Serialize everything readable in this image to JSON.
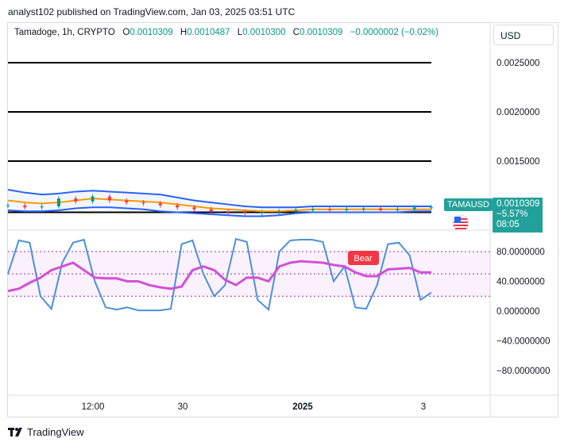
{
  "publisher_line": "analyst102 published on TradingView.com, Jan 03, 2025 03:51 UTC",
  "ohlc": {
    "symbol": "Tamadoge, 1h, CRYPTO",
    "o_label": "O",
    "o": "0.0010309",
    "h_label": "H",
    "h": "0.0010487",
    "l_label": "L",
    "l": "0.0010300",
    "c_label": "C",
    "c": "0.0010309",
    "change": "−0.0000002 (−0.02%)"
  },
  "currency": "USD",
  "price_tag": {
    "symbol": "TAMAUSD",
    "price": "0.0010309",
    "change": "−5.57%",
    "countdown": "08:05"
  },
  "footer": {
    "brand": "TradingView"
  },
  "colors": {
    "up": "#089981",
    "down": "#f23645",
    "bollinger": "#2962ff",
    "ma": "#ff9800",
    "rsi_slow": "#d24fd8",
    "rsi_fast": "#4a90d9",
    "tag": "#22a19b",
    "bear": "#f23645"
  },
  "chart_data": [
    {
      "type": "line",
      "panel": "price",
      "y_ticks": [
        "0.0025000",
        "0.0020000",
        "0.0015000"
      ],
      "ylim": [
        0.0008,
        0.0028
      ],
      "x_ticks": [
        "12:00",
        "30",
        "2025",
        "3"
      ],
      "horizontal_lines": [
        0.0025,
        0.002,
        0.0015,
        0.00098
      ],
      "series": [
        {
          "name": "",
          "role": "bollinger-upper",
          "values": [
            0.00121,
            0.00118,
            0.00116,
            0.00117,
            0.00119,
            0.0012,
            0.00119,
            0.00118,
            0.00117,
            0.00116,
            0.00113,
            0.0011,
            0.00108,
            0.00106,
            0.00104,
            0.00103,
            0.00103,
            0.00103,
            0.00104,
            0.00104,
            0.00104,
            0.00104,
            0.00104,
            0.00104,
            0.00104,
            0.00104
          ]
        },
        {
          "name": "",
          "role": "bollinger-lower",
          "values": [
            0.001,
            0.00099,
            0.00099,
            0.001,
            0.00102,
            0.00103,
            0.00103,
            0.00102,
            0.00101,
            0.00099,
            0.00098,
            0.00097,
            0.00096,
            0.00095,
            0.00094,
            0.00094,
            0.00095,
            0.00097,
            0.00098,
            0.00098,
            0.00098,
            0.00098,
            0.00098,
            0.00098,
            0.00099,
            0.00099
          ]
        },
        {
          "name": "",
          "role": "moving-average",
          "values": [
            0.0011,
            0.00108,
            0.00107,
            0.00108,
            0.0011,
            0.00112,
            0.00111,
            0.0011,
            0.00109,
            0.00108,
            0.00106,
            0.00104,
            0.00102,
            0.00101,
            0.001,
            0.00099,
            0.00099,
            0.001,
            0.00101,
            0.00101,
            0.00101,
            0.00101,
            0.00101,
            0.00101,
            0.00101,
            0.00101
          ]
        },
        {
          "name": "",
          "role": "price",
          "values": [
            0.00105,
            0.00103,
            0.00104,
            0.00112,
            0.00109,
            0.00114,
            0.0011,
            0.00108,
            0.00107,
            0.00105,
            0.00103,
            0.00101,
            0.00099,
            0.00098,
            0.00097,
            0.00098,
            0.00099,
            0.001,
            0.00101,
            0.001,
            0.00101,
            0.00102,
            0.001,
            0.00101,
            0.00103,
            0.00103
          ]
        }
      ]
    },
    {
      "type": "line",
      "panel": "oscillator",
      "y_ticks": [
        "80.0000000",
        "40.0000000",
        "0.0000000",
        "−40.0000000",
        "−80.0000000"
      ],
      "ylim": [
        -100,
        110
      ],
      "band": [
        20,
        80
      ],
      "annotation": "Bear",
      "series": [
        {
          "name": "",
          "role": "fast",
          "values": [
            50,
            95,
            92,
            20,
            3,
            65,
            92,
            96,
            40,
            5,
            2,
            5,
            1,
            1,
            1,
            3,
            90,
            95,
            50,
            20,
            35,
            97,
            93,
            15,
            2,
            80,
            95,
            96,
            96,
            93,
            40,
            60,
            5,
            3,
            35,
            90,
            92,
            75,
            15,
            25
          ]
        },
        {
          "name": "",
          "role": "slow",
          "values": [
            27,
            30,
            38,
            45,
            55,
            60,
            65,
            55,
            45,
            44,
            44,
            40,
            40,
            35,
            32,
            30,
            33,
            55,
            60,
            55,
            42,
            35,
            45,
            45,
            40,
            60,
            65,
            67,
            66,
            65,
            62,
            60,
            52,
            47,
            47,
            56,
            57,
            58,
            52,
            52
          ]
        }
      ]
    }
  ]
}
